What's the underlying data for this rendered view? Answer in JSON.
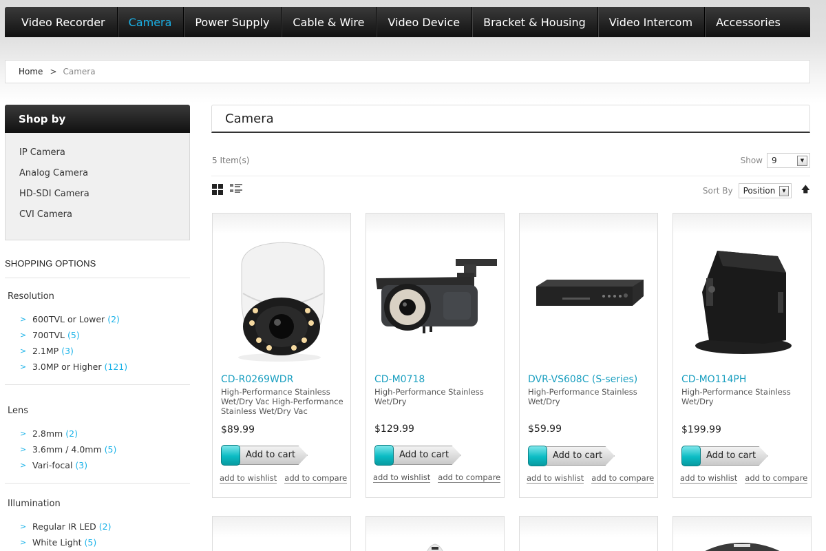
{
  "nav": {
    "items": [
      {
        "label": "Video Recorder"
      },
      {
        "label": "Camera"
      },
      {
        "label": "Power Supply"
      },
      {
        "label": "Cable & Wire"
      },
      {
        "label": "Video Device"
      },
      {
        "label": "Bracket & Housing"
      },
      {
        "label": "Video Intercom"
      },
      {
        "label": "Accessories"
      }
    ],
    "active_label": "Camera",
    "active_color": "#1ab2e8"
  },
  "breadcrumb": {
    "home": "Home",
    "separator": ">",
    "current": "Camera"
  },
  "sidebar": {
    "shop_by_title": "Shop by",
    "categories": [
      "IP Camera",
      "Analog Camera",
      "HD-SDI Camera",
      "CVI Camera"
    ],
    "shopping_options_title": "SHOPPING OPTIONS",
    "filters": [
      {
        "title": "Resolution",
        "items": [
          {
            "label": "600TVL or Lower",
            "count": "(2)"
          },
          {
            "label": "700TVL",
            "count": "(5)"
          },
          {
            "label": "2.1MP",
            "count": "(3)"
          },
          {
            "label": "3.0MP or Higher",
            "count": "(121)"
          }
        ]
      },
      {
        "title": "Lens",
        "items": [
          {
            "label": "2.8mm",
            "count": "(2)"
          },
          {
            "label": "3.6mm / 4.0mm",
            "count": "(5)"
          },
          {
            "label": "Vari-focal",
            "count": "(3)"
          }
        ]
      },
      {
        "title": "Illumination",
        "items": [
          {
            "label": "Regular IR LED",
            "count": "(2)"
          },
          {
            "label": "White Light",
            "count": "(5)"
          }
        ]
      }
    ]
  },
  "main": {
    "title": "Camera",
    "item_count": "5 Item(s)",
    "show_label": "Show",
    "show_value": "9",
    "sort_label": "Sort By",
    "sort_value": "Position",
    "products": [
      {
        "name": "CD-R0269WDR",
        "desc": "High-Performance Stainless Wet/Dry Vac High-Performance Stainless Wet/Dry Vac",
        "price": "$89.99",
        "cart_label": "Add to cart",
        "wishlist": "add to wishlist",
        "compare": "add to compare",
        "icon": "dome-camera-image"
      },
      {
        "name": "CD-M0718",
        "desc": "High-Performance Stainless Wet/Dry",
        "price": "$129.99",
        "cart_label": "Add to cart",
        "wishlist": "add to wishlist",
        "compare": "add to compare",
        "icon": "bullet-camera-image"
      },
      {
        "name": "DVR-VS608C (S-series)",
        "desc": "High-Performance Stainless Wet/Dry",
        "price": "$59.99",
        "cart_label": "Add to cart",
        "wishlist": "add to wishlist",
        "compare": "add to compare",
        "icon": "dvr-image"
      },
      {
        "name": "CD-MO114PH",
        "desc": "High-Performance Stainless Wet/Dry",
        "price": "$199.99",
        "cart_label": "Add to cart",
        "wishlist": "add to wishlist",
        "compare": "add to compare",
        "icon": "pinhole-camera-image"
      }
    ]
  }
}
